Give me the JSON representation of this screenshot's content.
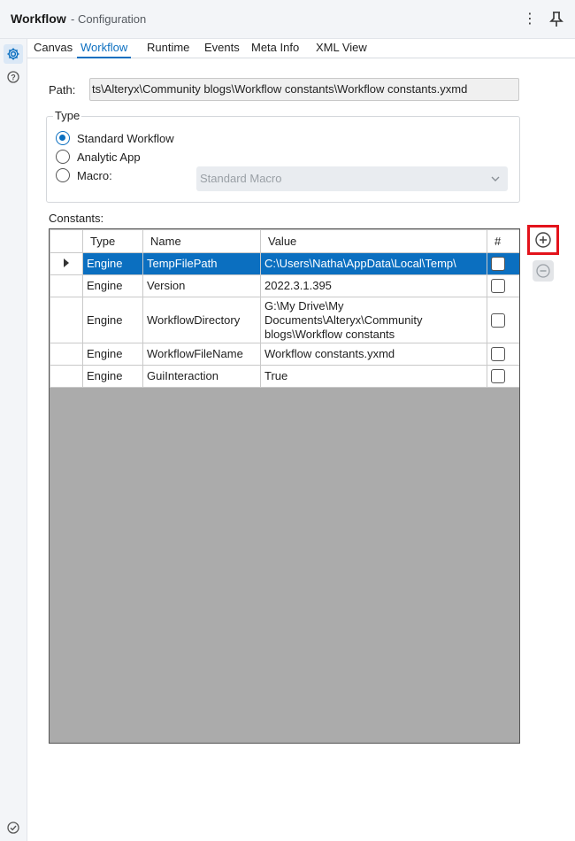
{
  "window": {
    "title": "Workflow",
    "subtitle": "- Configuration",
    "menu_icon": "more-vertical-icon",
    "pin_icon": "pin-icon"
  },
  "rail": {
    "items": [
      {
        "icon": "gear-icon",
        "active": true
      },
      {
        "icon": "help-icon",
        "active": false
      },
      {
        "icon": "check-circle-icon",
        "active": false
      }
    ]
  },
  "tabs": [
    {
      "label": "Canvas",
      "active": false
    },
    {
      "label": "Workflow",
      "active": true
    },
    {
      "label": "Runtime",
      "active": false
    },
    {
      "label": "Events",
      "active": false
    },
    {
      "label": "Meta Info",
      "active": false
    },
    {
      "label": "XML View",
      "active": false
    }
  ],
  "path": {
    "label": "Path:",
    "value": "G:\\My Drive\\My Documents\\Alteryx\\Community blogs\\Workflow constants\\Workflow constants.yxmd",
    "visible_value": "ts\\Alteryx\\Community blogs\\Workflow constants\\Workflow constants.yxmd"
  },
  "type_group": {
    "legend": "Type",
    "options": [
      {
        "label": "Standard Workflow",
        "checked": true
      },
      {
        "label": "Analytic App",
        "checked": false
      },
      {
        "label": "Macro:",
        "checked": false
      }
    ],
    "macro_select": {
      "value": "Standard Macro",
      "disabled": true
    }
  },
  "constants": {
    "label": "Constants:",
    "columns": [
      "Type",
      "Name",
      "Value",
      "#"
    ],
    "rows": [
      {
        "type": "Engine",
        "name": "TempFilePath",
        "value": "C:\\Users\\Natha\\AppData\\Local\\Temp\\",
        "numeric": false,
        "selected": true
      },
      {
        "type": "Engine",
        "name": "Version",
        "value": "2022.3.1.395",
        "numeric": false,
        "selected": false
      },
      {
        "type": "Engine",
        "name": "WorkflowDirectory",
        "value": "G:\\My Drive\\My Documents\\Alteryx\\Community blogs\\Workflow constants",
        "numeric": false,
        "selected": false
      },
      {
        "type": "Engine",
        "name": "WorkflowFileName",
        "value": "Workflow constants.yxmd",
        "numeric": false,
        "selected": false
      },
      {
        "type": "Engine",
        "name": "GuiInteraction",
        "value": "True",
        "numeric": false,
        "selected": false
      }
    ]
  },
  "actions": {
    "add_icon": "plus-circle-icon",
    "remove_icon": "minus-circle-icon",
    "highlight_color": "#e3131b"
  },
  "colors": {
    "accent": "#0b6fc0",
    "grid_background": "#ababab"
  }
}
